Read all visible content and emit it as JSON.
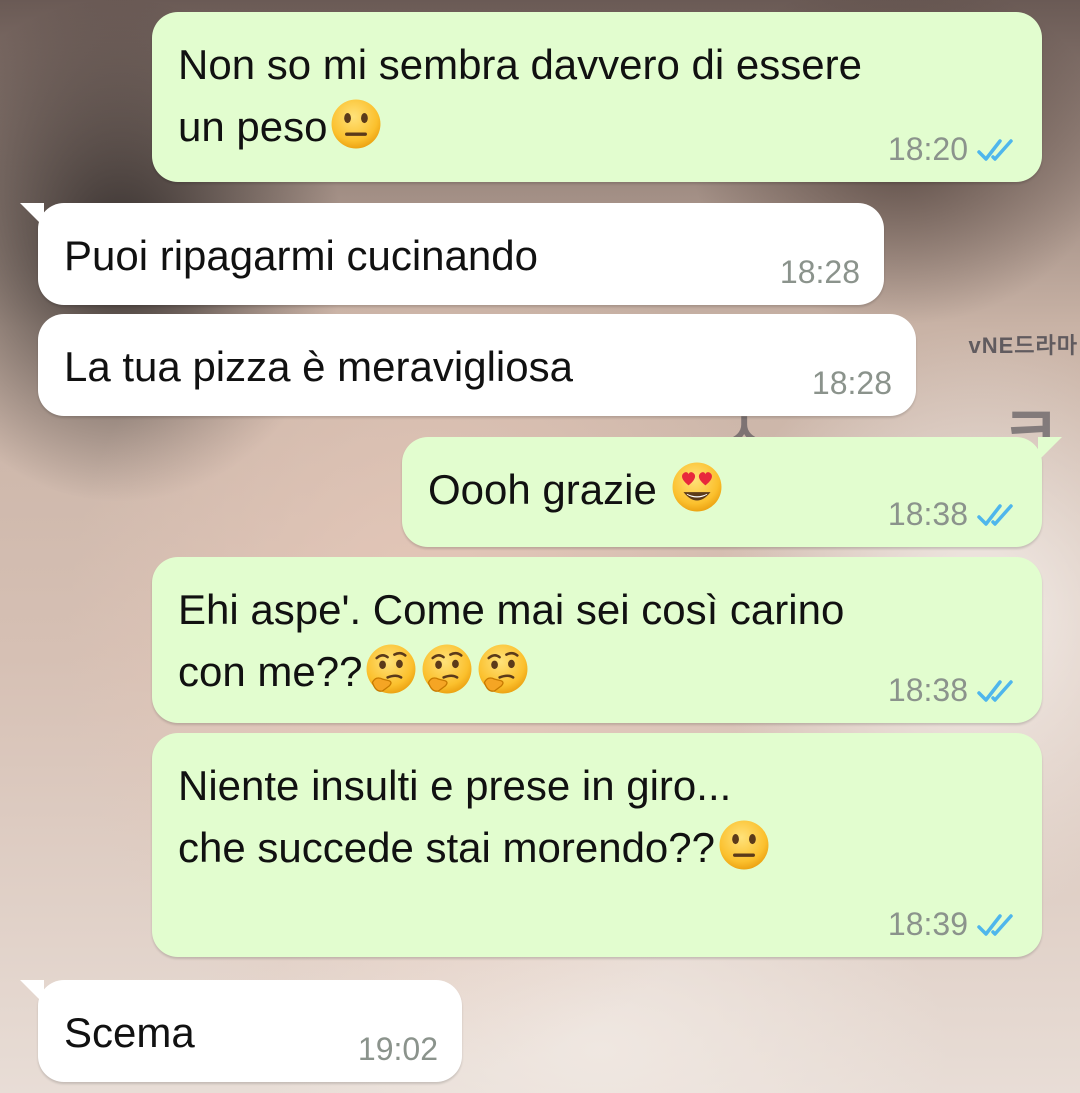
{
  "chat": {
    "messages": [
      {
        "id": "m1",
        "direction": "out",
        "lines": [
          "Non so mi sembra davvero di essere",
          "un peso"
        ],
        "emoji": [
          "neutral-face"
        ],
        "time": "18:20",
        "status": "read"
      },
      {
        "id": "m2",
        "direction": "in",
        "text": "Puoi ripagarmi cucinando",
        "time": "18:28"
      },
      {
        "id": "m3",
        "direction": "in",
        "text": "La tua pizza è meravigliosa",
        "time": "18:28"
      },
      {
        "id": "m4",
        "direction": "out",
        "text": "Oooh grazie ",
        "emoji": [
          "heart-eyes-face"
        ],
        "time": "18:38",
        "status": "read"
      },
      {
        "id": "m5",
        "direction": "out",
        "lines": [
          "Ehi aspe'. Come mai sei così carino",
          "con me??"
        ],
        "emoji": [
          "thinking-face",
          "thinking-face",
          "thinking-face"
        ],
        "time": "18:38",
        "status": "read"
      },
      {
        "id": "m6",
        "direction": "out",
        "lines": [
          "Niente insulti e prese in giro...",
          "che succede stai morendo??"
        ],
        "emoji": [
          "neutral-face"
        ],
        "time": "18:39",
        "status": "read"
      },
      {
        "id": "m7",
        "direction": "in",
        "text": "Scema",
        "time": "19:02"
      }
    ]
  },
  "wallpaper": {
    "visible_text": "vNE드라마"
  },
  "colors": {
    "outgoing_bubble": "#e2fdcf",
    "incoming_bubble": "#ffffff",
    "read_ticks": "#4fb6ec",
    "timestamp": "#8b938c"
  }
}
